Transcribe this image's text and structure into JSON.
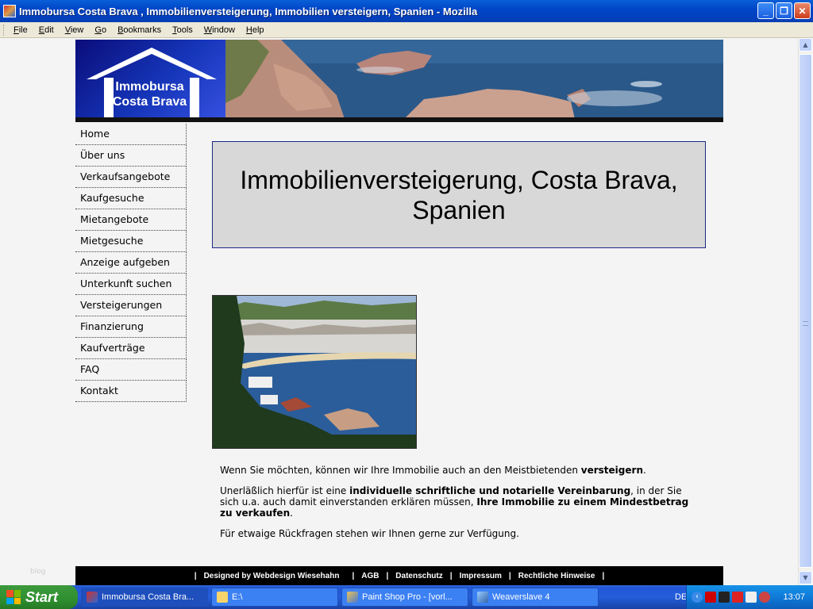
{
  "window": {
    "title": "Immobursa Costa Brava , Immobilienversteigerung, Immobilien versteigern, Spanien - Mozilla",
    "minimize": "_",
    "maximize": "❐",
    "close": "✕"
  },
  "menu": [
    "File",
    "Edit",
    "View",
    "Go",
    "Bookmarks",
    "Tools",
    "Window",
    "Help"
  ],
  "site": {
    "logo_line1": "Immobursa",
    "logo_line2": "Costa Brava",
    "nav": [
      "Home",
      "Über uns",
      "Verkaufsangebote",
      "Kaufgesuche",
      "Mietangebote",
      "Mietgesuche",
      "Anzeige aufgeben",
      "Unterkunft suchen",
      "Versteigerungen",
      "Finanzierung",
      "Kaufverträge",
      "FAQ",
      "Kontakt"
    ],
    "headline": "Immobilienversteigerung, Costa Brava, Spanien",
    "paragraph1_pre": "Wenn Sie möchten, können wir Ihre Immobilie auch an den Meistbietenden ",
    "paragraph1_bold": "versteigern",
    "paragraph1_post": ".",
    "paragraph2_pre": "Unerläßlich hierfür ist eine ",
    "paragraph2_bold1": "individuelle schriftliche und notarielle Vereinbarung",
    "paragraph2_mid": ", in der Sie sich u.a. auch damit einverstanden erklären müssen, ",
    "paragraph2_bold2": "Ihre Immobilie zu einem Mindestbetrag zu verkaufen",
    "paragraph2_post": ".",
    "paragraph3": "Für etwaige Rückfragen stehen wir Ihnen gerne zur Verfügung.",
    "footer": {
      "designed_by": "Designed by Webdesign Wiesehahn",
      "links": [
        "AGB",
        "Datenschutz",
        "Impressum",
        "Rechtliche Hinweise"
      ],
      "separator": "|"
    },
    "faint_text": "blog"
  },
  "taskbar": {
    "start": "Start",
    "tasks": [
      {
        "label": "Immobursa Costa Bra...",
        "icon": "mozilla-icon",
        "active": true
      },
      {
        "label": "E:\\",
        "icon": "folder-icon",
        "active": false
      },
      {
        "label": "Paint Shop Pro - [vorl...",
        "icon": "paintshop-icon",
        "active": false
      },
      {
        "label": "Weaverslave 4",
        "icon": "weaverslave-icon",
        "active": false
      }
    ],
    "language": "DE",
    "clock": "13:07"
  },
  "colors": {
    "headline_border": "#1c2a86",
    "headline_bg": "#d8d8d8",
    "footer_bg": "#000000",
    "page_bg": "#f4f4f4"
  }
}
